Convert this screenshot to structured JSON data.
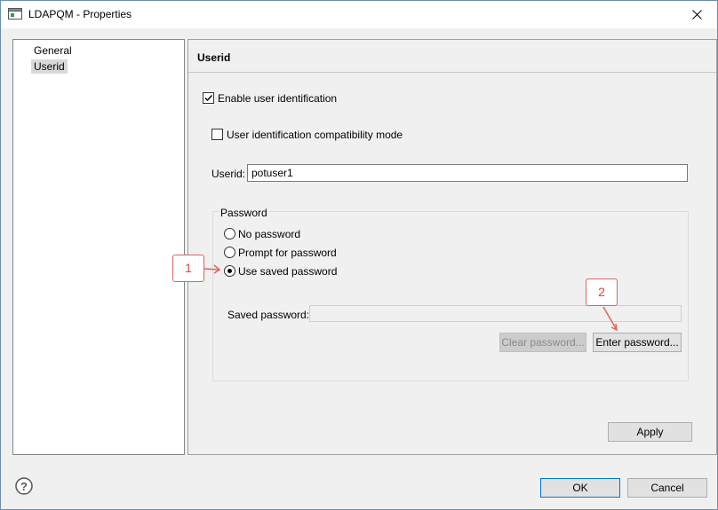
{
  "window": {
    "title": "LDAPQM - Properties",
    "accent": "#0078d7",
    "icons": [
      "app-icon",
      "close-icon",
      "help-icon"
    ]
  },
  "tree": {
    "items": [
      {
        "label": "General",
        "selected": false
      },
      {
        "label": "Userid",
        "selected": true
      }
    ]
  },
  "page": {
    "title": "Userid",
    "enable_userid": {
      "label": "Enable user identification",
      "checked": true
    },
    "compat_mode": {
      "label": "User identification compatibility mode",
      "checked": false
    },
    "userid": {
      "label": "Userid:",
      "value": "potuser1"
    },
    "password": {
      "group_label": "Password",
      "options": [
        {
          "label": "No password",
          "selected": false
        },
        {
          "label": "Prompt for password",
          "selected": false
        },
        {
          "label": "Use saved password",
          "selected": true
        }
      ],
      "saved_label": "Saved password:",
      "saved_value": "",
      "clear_label": "Clear password...",
      "enter_label": "Enter password..."
    },
    "apply_label": "Apply"
  },
  "footer": {
    "ok_label": "OK",
    "cancel_label": "Cancel"
  },
  "callouts": [
    {
      "number": "1"
    },
    {
      "number": "2"
    }
  ]
}
